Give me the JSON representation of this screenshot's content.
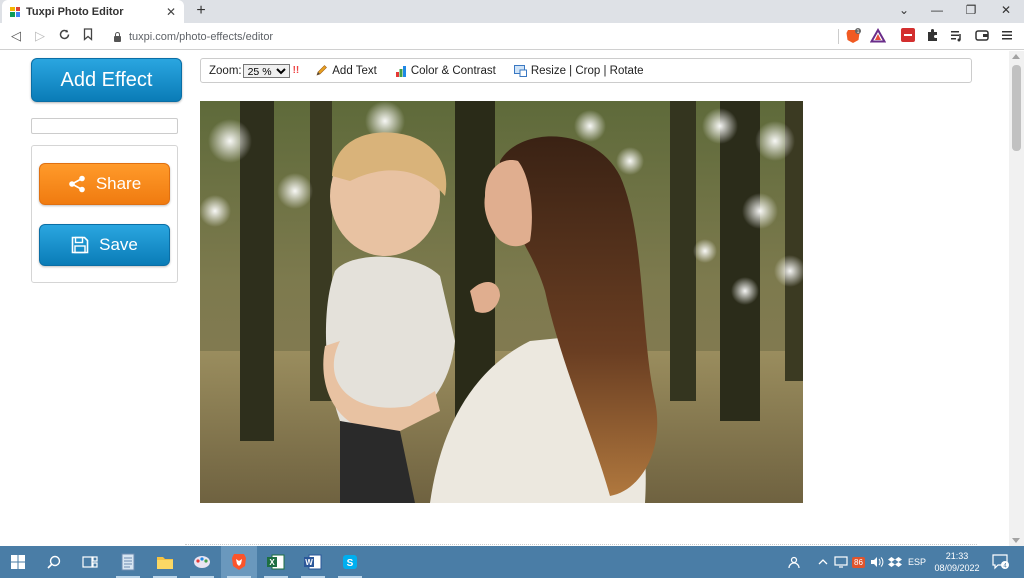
{
  "browser": {
    "tab_title": "Tuxpi Photo Editor",
    "tab_close": "✕",
    "new_tab": "+",
    "url": "tuxpi.com/photo-effects/editor",
    "brave_badge": "1",
    "window_controls": {
      "menu": "⌄",
      "minimize": "—",
      "restore": "❐",
      "close": "✕"
    }
  },
  "sidebar": {
    "add_effect_label": "Add Effect",
    "share_label": "Share",
    "save_label": "Save"
  },
  "toolbar": {
    "zoom_label": "Zoom:",
    "zoom_value": "25 %",
    "zoom_marker": "!!",
    "add_text_label": "Add Text",
    "color_contrast_label": "Color & Contrast",
    "resize_crop_rotate_label": "Resize | Crop | Rotate"
  },
  "taskbar": {
    "items": [
      {
        "icon": "windows-start-icon",
        "running": false,
        "active": false
      },
      {
        "icon": "search-icon",
        "running": false,
        "active": false
      },
      {
        "icon": "task-view-icon",
        "running": false,
        "active": false
      },
      {
        "icon": "notepad-icon",
        "running": true,
        "active": false
      },
      {
        "icon": "file-explorer-icon",
        "running": true,
        "active": false
      },
      {
        "icon": "paint-icon",
        "running": true,
        "active": false
      },
      {
        "icon": "brave-browser-icon",
        "running": true,
        "active": true
      },
      {
        "icon": "excel-icon",
        "running": true,
        "active": false
      },
      {
        "icon": "word-icon",
        "running": true,
        "active": false
      },
      {
        "icon": "skype-icon",
        "running": true,
        "active": false
      }
    ],
    "tray": {
      "badge_count": "86",
      "language": "ESP",
      "time": "21:33",
      "date": "08/09/2022",
      "notification_count": "4"
    }
  },
  "colors": {
    "blue_button": "#0a7cb7",
    "orange_button": "#f07b10",
    "taskbar": "#4a7da6"
  }
}
